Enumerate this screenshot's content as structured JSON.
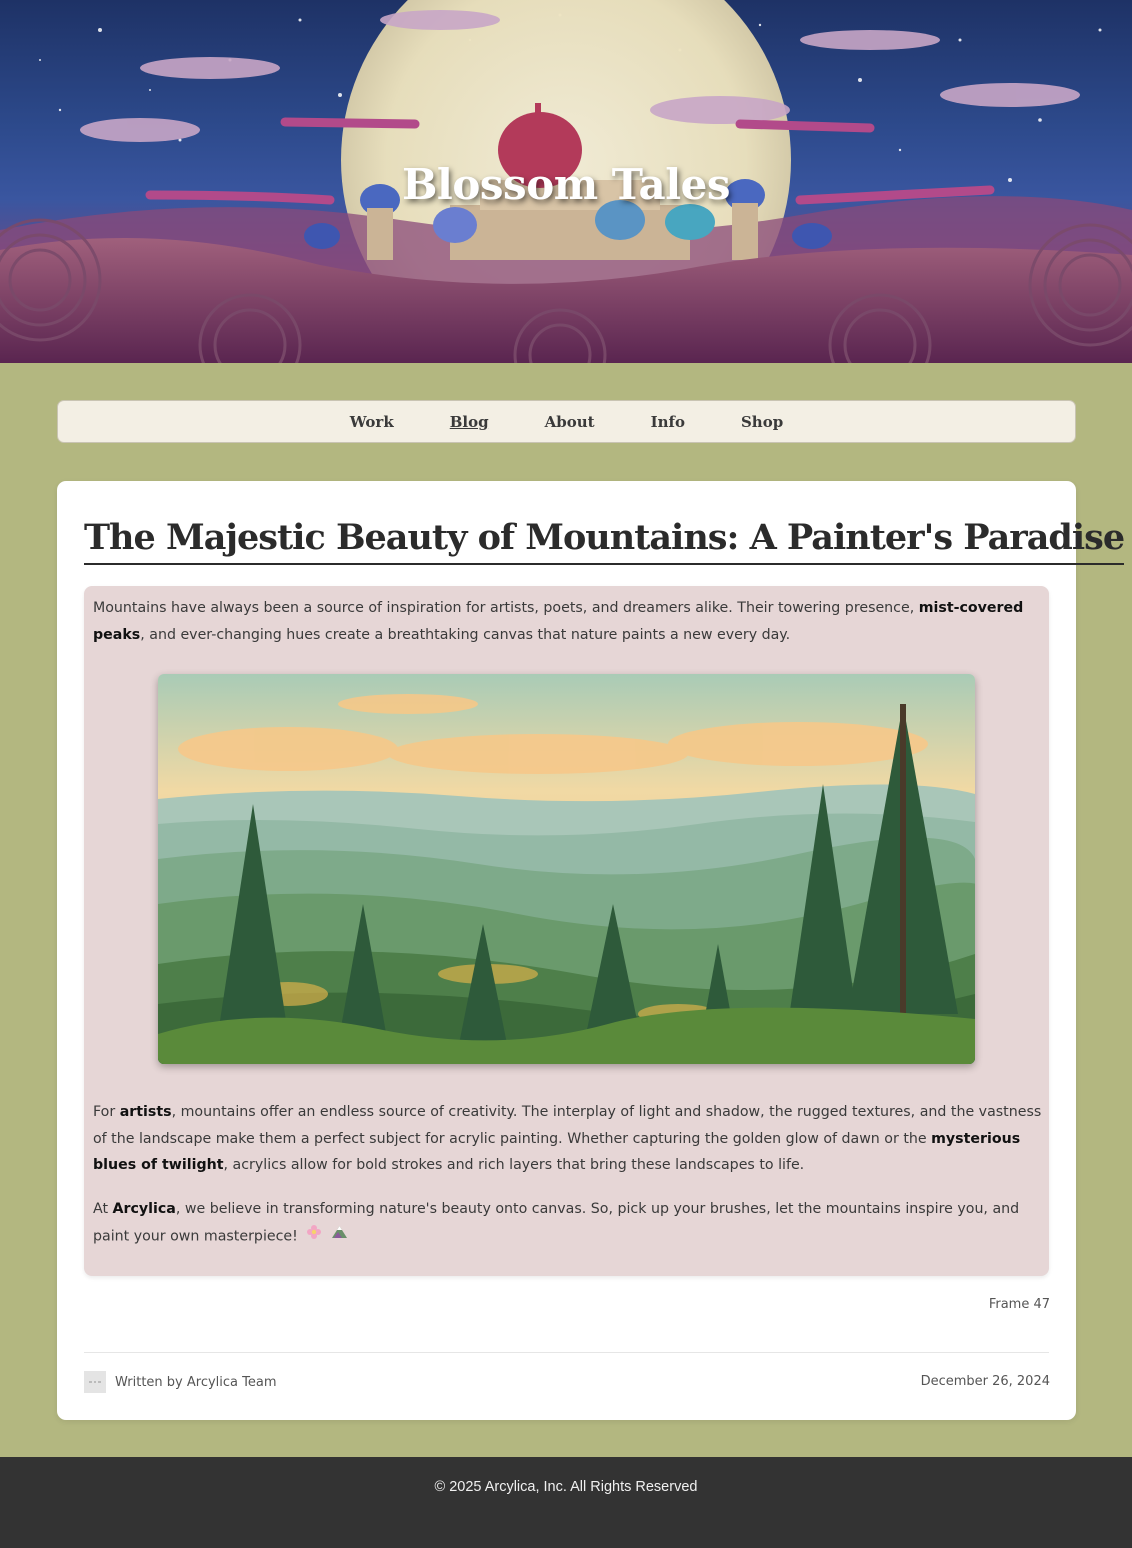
{
  "hero": {
    "title": "Blossom Tales"
  },
  "nav": {
    "items": [
      {
        "label": "Work"
      },
      {
        "label": "Blog"
      },
      {
        "label": "About"
      },
      {
        "label": "Info"
      },
      {
        "label": "Shop"
      }
    ],
    "active": "Blog"
  },
  "post": {
    "title": "The Majestic Beauty of Mountains: A Painter's Paradise",
    "p1": {
      "text_a": "Mountains have always been a source of inspiration for artists, poets, and dreamers alike. Their towering presence, ",
      "bold_a": "mist-covered peaks",
      "text_b": ", and ever-changing hues create a breathtaking canvas that nature paints a new every day."
    },
    "p2": {
      "text_a": "For ",
      "bold_a": "artists",
      "text_b": ", mountains offer an endless source of creativity. The interplay of light and shadow, the rugged textures, and the vastness of the landscape make them a perfect subject for acrylic painting. Whether capturing the golden glow of dawn or the ",
      "bold_b": "mysterious blues of twilight",
      "text_c": ", acrylics allow for bold strokes and rich layers that bring these landscapes to life."
    },
    "p3": {
      "text_a": "At ",
      "bold_a": "Arcylica",
      "text_b": ", we believe in transforming nature's beauty onto canvas. So, pick up your brushes, let the mountains inspire you, and paint your own masterpiece!",
      "emoji_a": "flower-emoji-icon",
      "emoji_b": "mountain-emoji-icon"
    },
    "frame_label": "Frame 47",
    "author": "Written by Arcylica Team",
    "date": "December 26, 2024"
  },
  "footer": {
    "text": "© 2025 Arcylica, Inc. All Rights Reserved"
  }
}
